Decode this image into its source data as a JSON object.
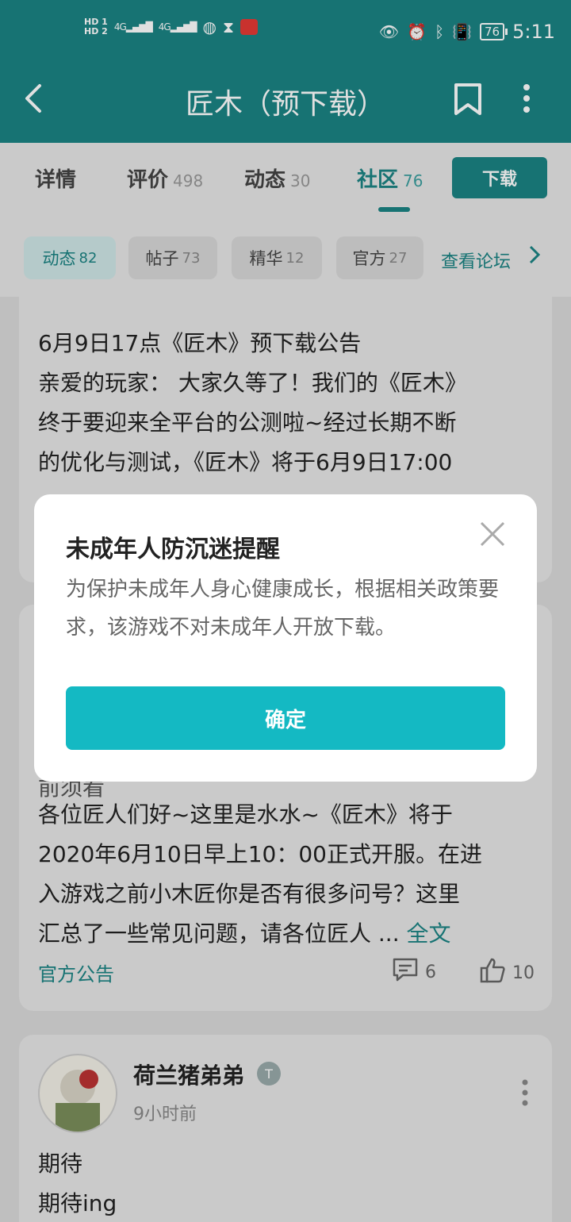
{
  "status_bar": {
    "hd1": "HD 1",
    "hd2": "HD 2",
    "signal1": "4G",
    "signal2": "4G",
    "battery": "76",
    "time": "5:11"
  },
  "header": {
    "title": "匠木（预下载）"
  },
  "tabs": [
    {
      "label": "详情",
      "count": ""
    },
    {
      "label": "评价",
      "count": "498"
    },
    {
      "label": "动态",
      "count": "30"
    },
    {
      "label": "社区",
      "count": "76"
    }
  ],
  "download_label": "下载",
  "chips": [
    {
      "label": "动态",
      "count": "82"
    },
    {
      "label": "帖子",
      "count": "73"
    },
    {
      "label": "精华",
      "count": "12"
    },
    {
      "label": "官方",
      "count": "27"
    }
  ],
  "forum_link": "查看论坛",
  "card1": {
    "lines": [
      "6月9日17点《匠木》预下载公告",
      "亲爱的玩家： 大家久等了！我们的《匠木》",
      "终于要迎来全平台的公测啦~经过长期不断",
      "的优化与测试，《匠木》将于6月9日17:00"
    ]
  },
  "card2": {
    "partial_line": "前须看",
    "lines": [
      "各位匠人们好~这里是水水~《匠木》将于",
      "2020年6月10日早上10：00正式开服。在进",
      "入游戏之前小木匠你是否有很多问号？这里"
    ],
    "last_line": "汇总了一些常见问题，请各位匠人 ...",
    "fulltext": "全文",
    "tag": "官方公告",
    "comments": "6",
    "likes": "10"
  },
  "card3": {
    "author": "荷兰猪弟弟",
    "badge": "T",
    "time": "9小时前",
    "lines": [
      "期待",
      "期待ing"
    ]
  },
  "dialog": {
    "title": "未成年人防沉迷提醒",
    "body": "为保护未成年人身心健康成长，根据相关政策要求，该游戏不对未成年人开放下载。",
    "confirm": "确定"
  }
}
